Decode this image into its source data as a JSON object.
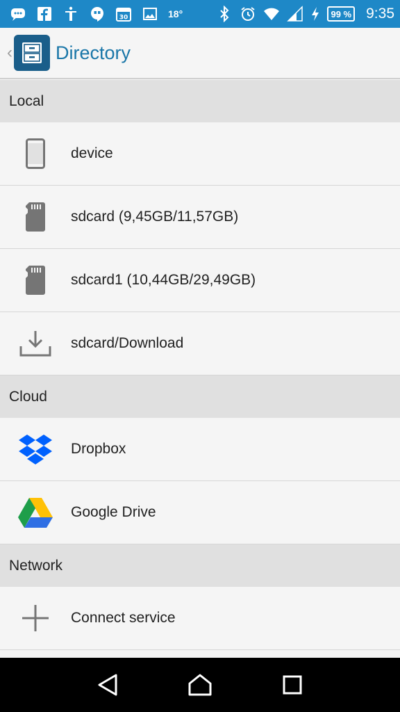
{
  "status_bar": {
    "temperature": "18°",
    "battery": "99 %",
    "time": "9:35",
    "color": "#1e88c7"
  },
  "app_bar": {
    "title": "Directory",
    "title_color": "#1976a8"
  },
  "sections": {
    "local": {
      "header": "Local",
      "items": [
        {
          "label": "device",
          "icon": "phone-icon"
        },
        {
          "label": "sdcard (9,45GB/11,57GB)",
          "icon": "sdcard-icon"
        },
        {
          "label": "sdcard1 (10,44GB/29,49GB)",
          "icon": "sdcard-icon"
        },
        {
          "label": "sdcard/Download",
          "icon": "download-icon"
        }
      ]
    },
    "cloud": {
      "header": "Cloud",
      "items": [
        {
          "label": "Dropbox",
          "icon": "dropbox-icon"
        },
        {
          "label": "Google Drive",
          "icon": "google-drive-icon"
        }
      ]
    },
    "network": {
      "header": "Network",
      "items": [
        {
          "label": "Connect service",
          "icon": "plus-icon"
        }
      ]
    }
  }
}
